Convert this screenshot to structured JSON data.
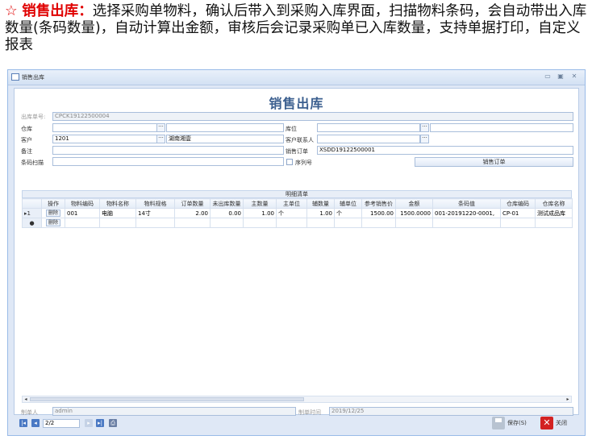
{
  "caption": {
    "star": "☆",
    "label": "销售出库：",
    "text": "选择采购单物料，确认后带入到采购入库界面，扫描物料条码，会自动带出入库数量(条码数量)，自动计算出金额，审核后会记录采购单已入库数量，支持单据打印，自定义报表"
  },
  "window": {
    "title": "销售出库",
    "form_title": "销售出库"
  },
  "form": {
    "doc_no_label": "出库单号:",
    "doc_no_value": "CPCK19122500004",
    "warehouse_label": "仓库",
    "warehouse_value": "",
    "location_label": "库位",
    "location_value": "",
    "customer_label": "客户",
    "customer_code": "1201",
    "customer_name": "湖南湘壹",
    "contact_label": "客户联系人",
    "contact_value": "",
    "remark_label": "备注",
    "remark_value": "",
    "sales_order_label": "销售订单",
    "sales_order_value": "XSDD19122500001",
    "barcode_label": "条码扫描",
    "barcode_value": "",
    "serial_label": "序列号",
    "sales_order_button": "销售订单",
    "dots": "···"
  },
  "grid": {
    "title": "明细清单",
    "columns": [
      "",
      "操作",
      "物料编码",
      "物料名称",
      "物料规格",
      "订单数量",
      "未出库数量",
      "主数量",
      "主单位",
      "辅数量",
      "辅单位",
      "参考销售价",
      "金额",
      "条码值",
      "仓库编码",
      "仓库名称"
    ],
    "delete_label": "删除",
    "rows": [
      {
        "marker": "▸1",
        "code": "001",
        "name": "电脑",
        "spec": "14寸",
        "order_qty": "2.00",
        "unshipped_qty": "0.00",
        "main_qty": "1.00",
        "main_unit": "个",
        "aux_qty": "1.00",
        "aux_unit": "个",
        "ref_price": "1500.00",
        "amount": "1500.0000",
        "barcode": "001-20191220-0001,",
        "wh_code": "CP-01",
        "wh_name": "测试成品库"
      },
      {
        "marker": "●",
        "code": "",
        "name": "",
        "spec": "",
        "order_qty": "",
        "unshipped_qty": "",
        "main_qty": "",
        "main_unit": "",
        "aux_qty": "",
        "aux_unit": "",
        "ref_price": "",
        "amount": "",
        "barcode": "",
        "wh_code": "",
        "wh_name": ""
      }
    ]
  },
  "bottom": {
    "maker_label": "制单人",
    "maker_value": "admin",
    "time_label": "制单时间",
    "time_value": "2019/12/25"
  },
  "footer": {
    "page_value": "2/2",
    "save_label": "保存(S)",
    "close_label": "关闭"
  },
  "colors": {
    "accent": "#e00000",
    "window_bg": "#dfe8f6",
    "border": "#99bbe8",
    "title_text": "#3b5f8f"
  }
}
